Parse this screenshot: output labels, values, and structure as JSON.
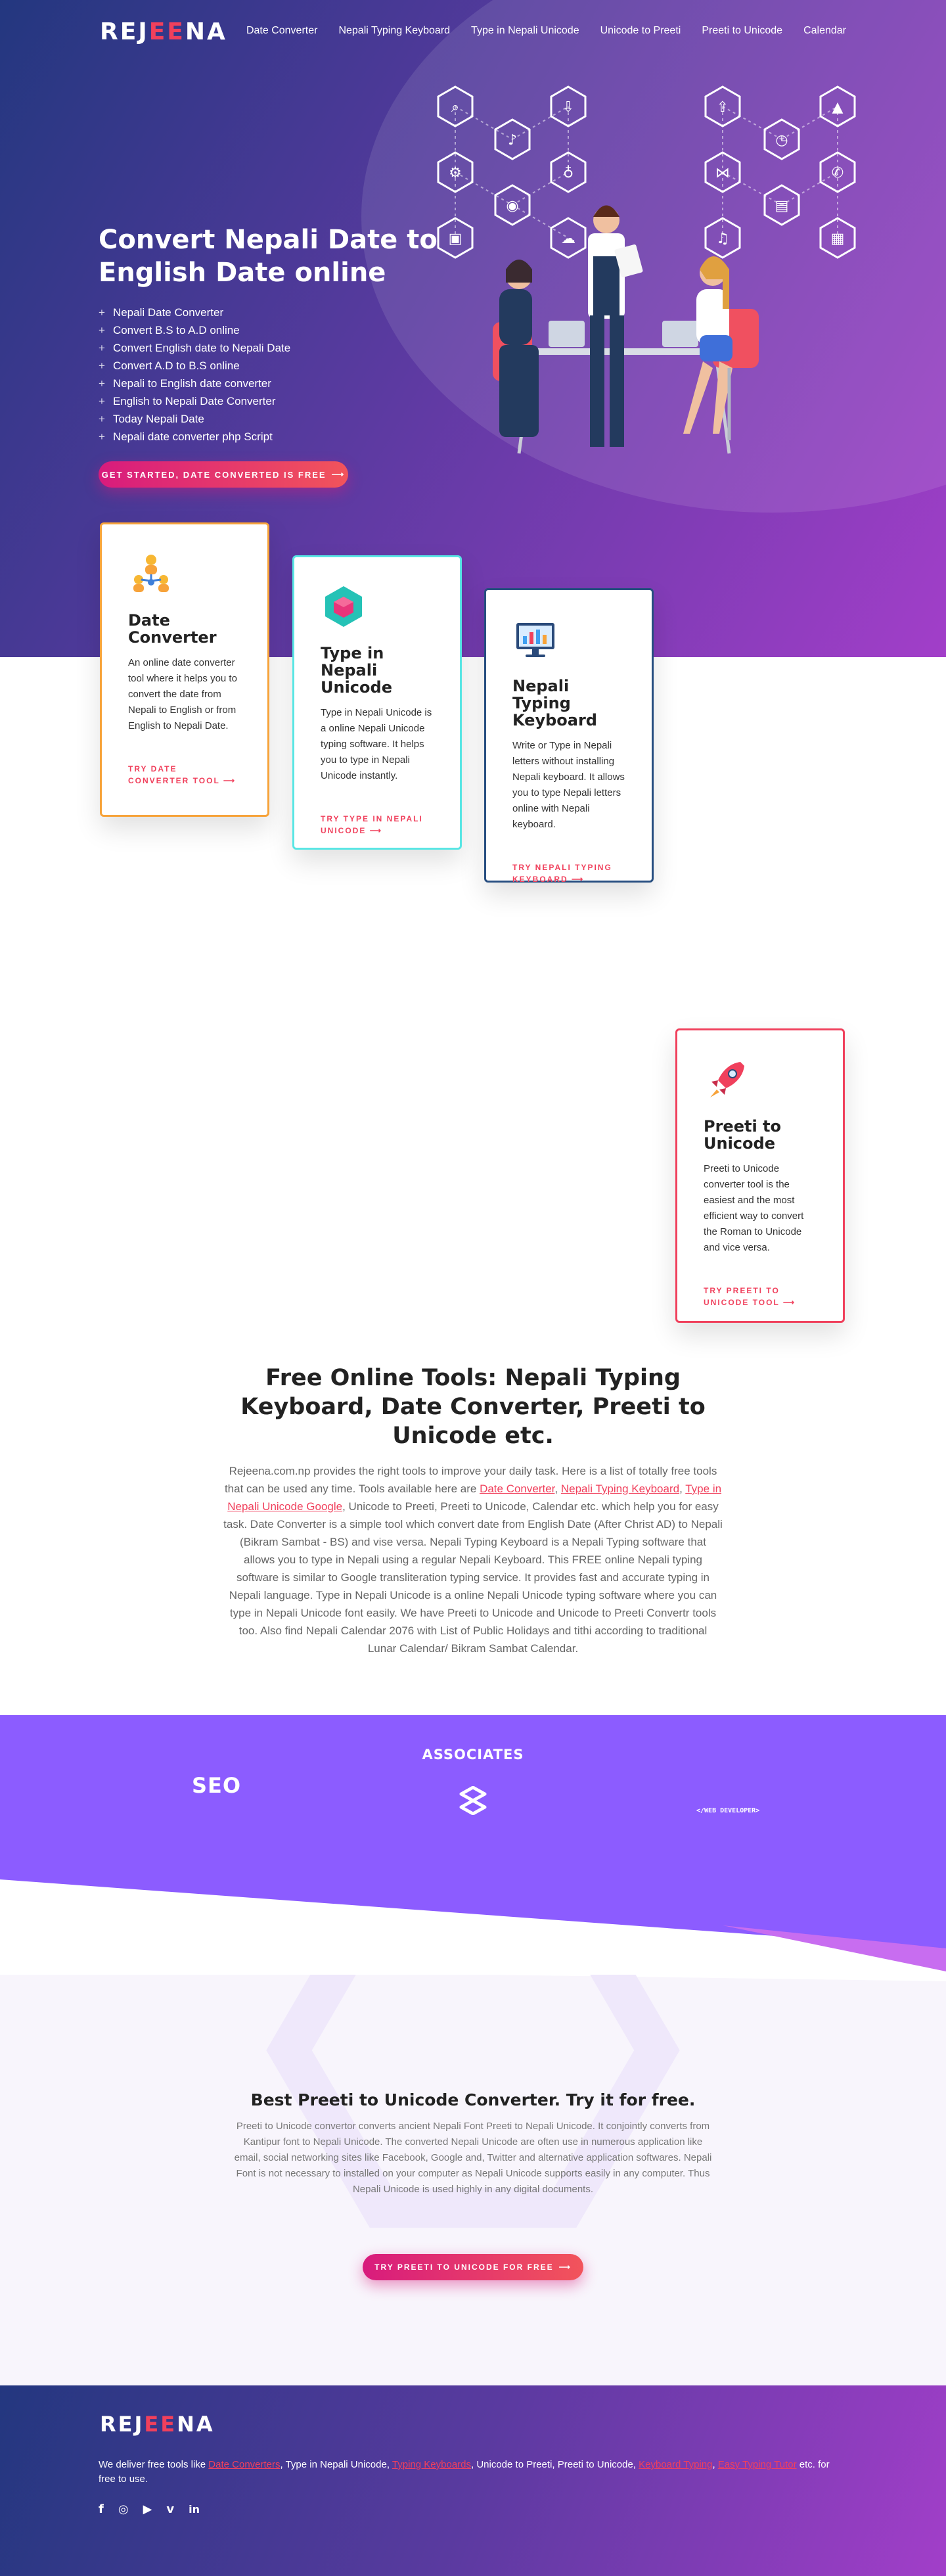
{
  "brand": {
    "logo_prefix": "REJ",
    "logo_mid": "EE",
    "logo_suffix": "NA"
  },
  "nav": {
    "items": [
      "Date Converter",
      "Nepali Typing Keyboard",
      "Type in Nepali Unicode",
      "Unicode to Preeti",
      "Preeti to Unicode",
      "Calendar"
    ]
  },
  "hero": {
    "title": "Convert Nepali Date to English Date online",
    "list": [
      "Nepali Date Converter",
      "Convert B.S to A.D online",
      "Convert English date to Nepali Date",
      "Convert A.D to B.S online",
      "Nepali to English date converter",
      "English to Nepali Date Converter",
      "Today Nepali Date",
      "Nepali date converter php Script"
    ],
    "button": "GET STARTED, DATE CONVERTED IS FREE"
  },
  "cards": [
    {
      "title": "Date Converter",
      "text": "An online date converter tool where it helps you to convert the date from Nepali to English or from English to Nepali Date.",
      "cta": "TRY DATE CONVERTER TOOL",
      "icon": "people-network-icon"
    },
    {
      "title": "Type in Nepali Unicode",
      "text": "Type in Nepali Unicode is a online Nepali Unicode typing software. It helps you to type in Nepali Unicode instantly.",
      "cta": "TRY TYPE IN NEPALI UNICODE",
      "icon": "cube-icon"
    },
    {
      "title": "Nepali Typing Keyboard",
      "text": "Write or Type in Nepali letters without installing Nepali keyboard. It allows you to type Nepali letters online with Nepali keyboard.",
      "cta": "TRY NEPALI TYPING KEYBOARD",
      "icon": "monitor-chart-icon"
    },
    {
      "title": "Preeti to Unicode",
      "text": "Preeti to Unicode converter tool is the easiest and the most efficient way to convert the Roman to Unicode and vice versa.",
      "cta": "TRY PREETI TO UNICODE TOOL",
      "icon": "rocket-icon"
    }
  ],
  "intro": {
    "title": "Free Online Tools: Nepali Typing Keyboard, Date Converter, Preeti to Unicode etc.",
    "p1": "Rejeena.com.np provides the right tools to improve your daily task. Here is a list of totally free tools that can be used any time. Tools available here are",
    "link1": "Date Converter",
    "sep1": ",",
    "link2": "Nepali Typing Keyboard",
    "sep2": ",",
    "link3": "Type in Nepali Unicode Google",
    "p2": ", Unicode to Preeti, Preeti to Unicode, Calendar etc. which help you for easy task. Date Converter is a simple tool which convert date from English Date (After Christ AD) to Nepali (Bikram Sambat - BS) and vise versa. Nepali Typing Keyboard is a Nepali Typing software that allows you to type in Nepali using a regular Nepali Keyboard. This FREE online Nepali typing software is similar to Google transliteration typing service. It provides fast and accurate typing in Nepali language. Type in Nepali Unicode is a online Nepali Unicode typing software where you can type in Nepali Unicode font easily. We have Preeti to Unicode and Unicode to Preeti Convertr tools too. Also find Nepali Calendar 2076 with List of Public Holidays and tithi according to traditional Lunar Calendar/ Bikram Sambat Calendar."
  },
  "associates": {
    "title": "ASSOCIATES",
    "logo1": "SEO",
    "logo3": "</WEB DEVELOPER>"
  },
  "promo": {
    "title": "Best Preeti to Unicode Converter. Try it for free.",
    "text": "Preeti to Unicode convertor converts ancient Nepali Font Preeti to Nepali Unicode. It conjointly converts from Kantipur font to Nepali Unicode. The converted Nepali Unicode are often use in numerous application like email, social networking sites like Facebook, Google and, Twitter and alternative application softwares. Nepali Font is not necessary to installed on your computer as Nepali Unicode supports easily in any computer. Thus Nepali Unicode is used highly in any digital documents.",
    "button": "TRY PREETI TO UNICODE FOR FREE"
  },
  "footer": {
    "t1": "We deliver free tools like",
    "l1": "Date Converters",
    "t2": ", Type in Nepali Unicode,",
    "l2": "Typing Keyboards",
    "t3": ", Unicode to Preeti, Preeti to Unicode,",
    "l3": "Keyboard Typing",
    "t4": ",",
    "l4": "Easy Typing Tutor",
    "t5": "etc. for free to use.",
    "social": [
      "facebook-icon",
      "instagram-icon",
      "youtube-icon",
      "vimeo-icon",
      "linkedin-icon"
    ]
  },
  "colors": {
    "accent": "#f0405c",
    "hero_start": "#23377f",
    "hero_end": "#a23ec9",
    "associates": "#8c5cff"
  }
}
